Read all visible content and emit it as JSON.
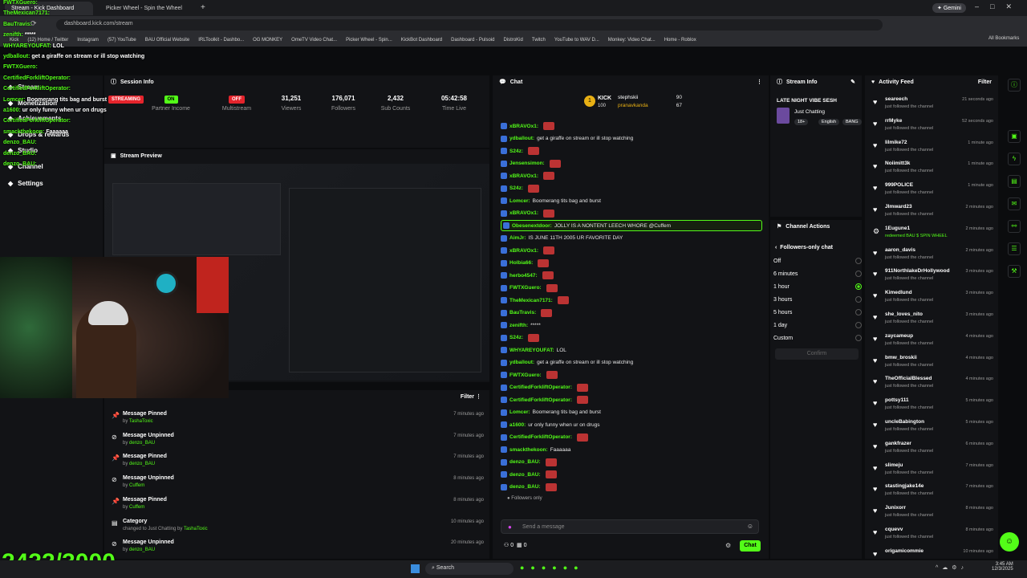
{
  "browser": {
    "tabs": [
      "Stream - Kick Dashboard",
      "Picker Wheel - Spin the Wheel"
    ],
    "url": "dashboard.kick.com/stream",
    "gemini": "Gemini",
    "bookmarks": [
      "Kick",
      "(12) Home / Twitter",
      "Instagram",
      "(57) YouTube",
      "BAU Official Website",
      "IRLToolkit - Dashbo...",
      "OG MONKEY",
      "OmeTV Video Chat...",
      "Picker Wheel - Spin...",
      "KickBot Dashboard",
      "Dashboard - Pulsoid",
      "DistroKid",
      "Twitch",
      "YouTube to WAV D...",
      "Monkey: Video Chat...",
      "Home - Roblox"
    ],
    "all_bookmarks": "All Bookmarks"
  },
  "sidebar": {
    "items": [
      "Stream",
      "Monetization",
      "Achievements",
      "Drops & rewards",
      "Studio",
      "Channel",
      "Settings"
    ]
  },
  "session": {
    "title": "Session Info",
    "stats": [
      {
        "value": "STREAMING",
        "label": ""
      },
      {
        "value": "ON",
        "label": "Partner Income"
      },
      {
        "value": "OFF",
        "label": "Multistream"
      },
      {
        "value": "31,251",
        "label": "Viewers"
      },
      {
        "value": "176,071",
        "label": "Followers"
      },
      {
        "value": "2,432",
        "label": "Sub Counts"
      },
      {
        "value": "05:42:58",
        "label": "Time Live"
      }
    ],
    "preview_title": "Stream Preview"
  },
  "modlog": {
    "filter": "Filter",
    "rows": [
      {
        "action": "Message Pinned",
        "by": "by",
        "user": "TashaToxic",
        "time": "7 minutes ago"
      },
      {
        "action": "Message Unpinned",
        "by": "by",
        "user": "denzo_BAU",
        "time": "7 minutes ago"
      },
      {
        "action": "Message Pinned",
        "by": "by",
        "user": "denzo_BAU",
        "time": "7 minutes ago"
      },
      {
        "action": "Message Unpinned",
        "by": "by",
        "user": "Cuffem",
        "time": "8 minutes ago"
      },
      {
        "action": "Message Pinned",
        "by": "by",
        "user": "Cuffem",
        "time": "8 minutes ago"
      },
      {
        "action": "Category",
        "by": "changed to Just Chatting by",
        "user": "TashaToxic",
        "time": "10 minutes ago"
      },
      {
        "action": "Message Unpinned",
        "by": "by",
        "user": "denzo_BAU",
        "time": "20 minutes ago"
      }
    ]
  },
  "chat": {
    "title": "Chat",
    "kick_label": "KICK",
    "kick_count": "100",
    "top": [
      {
        "name": "stephskii",
        "count": "90"
      },
      {
        "name": "pranavkanda",
        "count": "67"
      }
    ],
    "messages": [
      {
        "user": "xBRAVOx1:",
        "text": ""
      },
      {
        "user": "ydballout:",
        "text": "get a giraffe on stream or ill stop watching"
      },
      {
        "user": "S24z:",
        "text": ""
      },
      {
        "user": "Jensensimon:",
        "text": ""
      },
      {
        "user": "xBRAVOx1:",
        "text": ""
      },
      {
        "user": "S24z:",
        "text": ""
      },
      {
        "user": "Lomcer:",
        "text": "Boomerang tits bag and burst"
      },
      {
        "user": "xBRAVOx1:",
        "text": ""
      },
      {
        "user": "Obesenextdoor:",
        "text": "JOLLY IS A NONTENT LEECH WHORE @Cuffem"
      },
      {
        "user": "AimJr:",
        "text": "IS JUNE 11TH 2005 UR FAVORITE DAY"
      },
      {
        "user": "xBRAVOx1:",
        "text": ""
      },
      {
        "user": "Holbia66:",
        "text": ""
      },
      {
        "user": "herbo4547:",
        "text": ""
      },
      {
        "user": "FWTXGuero:",
        "text": ""
      },
      {
        "user": "TheMexican7171:",
        "text": ""
      },
      {
        "user": "BauTravis:",
        "text": ""
      },
      {
        "user": "zenifth:",
        "text": "*****"
      },
      {
        "user": "S24z:",
        "text": ""
      },
      {
        "user": "WHYAREYOUFAT:",
        "text": "LOL"
      },
      {
        "user": "ydballout:",
        "text": "get a giraffe on stream or ill stop watching"
      },
      {
        "user": "FWTXGuero:",
        "text": ""
      },
      {
        "user": "CertifiedForkliftOperator:",
        "text": ""
      },
      {
        "user": "CertifiedForkliftOperator:",
        "text": ""
      },
      {
        "user": "Lomcer:",
        "text": "Boomerang tits bag and burst"
      },
      {
        "user": "a1600:",
        "text": "ur only funny when ur on drugs"
      },
      {
        "user": "CertifiedForkliftOperator:",
        "text": ""
      },
      {
        "user": "smackthekoon:",
        "text": "Faaaaaa"
      },
      {
        "user": "denzo_BAU:",
        "text": ""
      },
      {
        "user": "denzo_BAU:",
        "text": ""
      },
      {
        "user": "denzo_BAU:",
        "text": ""
      }
    ],
    "followers_only": "Followers only",
    "placeholder": "Send a message",
    "counts": [
      "0",
      "0"
    ],
    "send": "Chat"
  },
  "stream_info": {
    "title": "Stream Info",
    "stream_title": "LATE NIGHT VIBE SESH",
    "category": "Just Chatting",
    "tags": [
      "18+",
      "English",
      "BANG"
    ]
  },
  "channel_actions": {
    "title": "Channel Actions",
    "sub": "Followers-only chat",
    "options": [
      "Off",
      "6 minutes",
      "1 hour",
      "3 hours",
      "5 hours",
      "1 day",
      "Custom"
    ],
    "selected": 2,
    "confirm": "Confirm"
  },
  "activity": {
    "title": "Activity Feed",
    "filter": "Filter",
    "items": [
      {
        "name": "seareech",
        "sub": "just followed the channel",
        "time": "21 seconds ago"
      },
      {
        "name": "rrMyke",
        "sub": "just followed the channel",
        "time": "52 seconds ago"
      },
      {
        "name": "lilmike72",
        "sub": "just followed the channel",
        "time": "1 minute ago"
      },
      {
        "name": "Noiimitt3k",
        "sub": "just followed the channel",
        "time": "1 minute ago"
      },
      {
        "name": "999POLICE",
        "sub": "just followed the channel",
        "time": "1 minute ago"
      },
      {
        "name": "Jlmward23",
        "sub": "just followed the channel",
        "time": "2 minutes ago"
      },
      {
        "name": "1Eugune1",
        "sub": "redeemed BAU $ SPIN WHEEL",
        "time": "2 minutes ago"
      },
      {
        "name": "aaron_davis",
        "sub": "just followed the channel",
        "time": "2 minutes ago"
      },
      {
        "name": "911NorthlakeDrHollywood",
        "sub": "just followed the channel",
        "time": "3 minutes ago"
      },
      {
        "name": "Kimedlund",
        "sub": "just followed the channel",
        "time": "3 minutes ago"
      },
      {
        "name": "she_loves_nito",
        "sub": "just followed the channel",
        "time": "3 minutes ago"
      },
      {
        "name": "zaycameup",
        "sub": "just followed the channel",
        "time": "4 minutes ago"
      },
      {
        "name": "bmw_broskii",
        "sub": "just followed the channel",
        "time": "4 minutes ago"
      },
      {
        "name": "TheOfficialBlessed",
        "sub": "just followed the channel",
        "time": "4 minutes ago"
      },
      {
        "name": "pottsy111",
        "sub": "just followed the channel",
        "time": "5 minutes ago"
      },
      {
        "name": "uncleBabington",
        "sub": "just followed the channel",
        "time": "5 minutes ago"
      },
      {
        "name": "gankfrazer",
        "sub": "just followed the channel",
        "time": "6 minutes ago"
      },
      {
        "name": "slimeju",
        "sub": "just followed the channel",
        "time": "7 minutes ago"
      },
      {
        "name": "stastingjake14e",
        "sub": "just followed the channel",
        "time": "7 minutes ago"
      },
      {
        "name": "Junixorr",
        "sub": "just followed the channel",
        "time": "8 minutes ago"
      },
      {
        "name": "cquevv",
        "sub": "just followed the channel",
        "time": "8 minutes ago"
      },
      {
        "name": "origamicommie",
        "sub": "",
        "time": "10 minutes ago"
      }
    ]
  },
  "overlay": {
    "counter": "2432/3000",
    "chat": [
      {
        "user": "FWTXGuero:",
        "text": ""
      },
      {
        "user": "TheMexican7171:",
        "text": ""
      },
      {
        "user": "BauTravis:",
        "text": ""
      },
      {
        "user": "zenifth:",
        "text": "*****"
      },
      {
        "user": "WHYAREYOUFAT:",
        "text": "LOL"
      },
      {
        "user": "ydballout:",
        "text": "get a giraffe on stream or ill stop watching"
      },
      {
        "user": "FWTXGuero:",
        "text": ""
      },
      {
        "user": "CertifiedForkliftOperator:",
        "text": ""
      },
      {
        "user": "CertifiedForkliftOperator:",
        "text": ""
      },
      {
        "user": "Lomcer:",
        "text": "Boomerang tits bag and burst"
      },
      {
        "user": "a1600:",
        "text": "ur only funny when ur on drugs"
      },
      {
        "user": "CertifiedForkliftOperator:",
        "text": ""
      },
      {
        "user": "smackthekoon:",
        "text": "Faaaaaa"
      },
      {
        "user": "denzo_BAU:",
        "text": ""
      },
      {
        "user": "denzo_BAU:",
        "text": ""
      },
      {
        "user": "denzo_BAU:",
        "text": ""
      }
    ]
  },
  "taskbar": {
    "search": "Search",
    "time": "3:45 AM",
    "date": "12/3/2025"
  }
}
